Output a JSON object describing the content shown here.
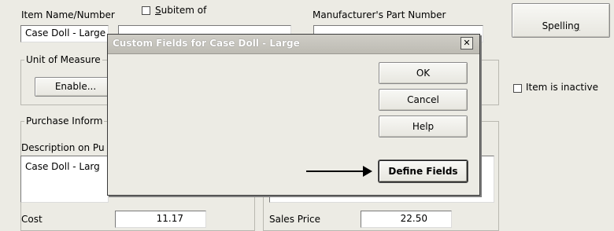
{
  "form": {
    "item_name_label": "Item Name/Number",
    "item_name_value": "Case Doll - Large",
    "subitem_label_u": "S",
    "subitem_label_rest": "ubitem of",
    "mfr_part_label": "Manufacturer's Part Number",
    "spelling_label_main": "Spellin",
    "spelling_label_u": "g",
    "uom_group_label": "Unit of Measure",
    "enable_button": "Enable...",
    "item_inactive_label": "Item is inactive",
    "purchase_group_label": "Purchase Inform",
    "purchase_desc_label": "Description on Pu",
    "purchase_desc_value": "Case Doll - Larg",
    "cost_label": "Cost",
    "cost_value": "11.17",
    "sales_price_label": "Sales Price",
    "sales_price_value": "22.50"
  },
  "dialog": {
    "title": "Custom Fields for Case Doll - Large",
    "close_glyph": "✕",
    "ok_label": "OK",
    "cancel_label": "Cancel",
    "help_label": "Help",
    "define_fields_label": "Define Fields"
  },
  "colors": {
    "background": "#ecebe4",
    "dialog_title_bar": "#c8c6bf",
    "annotation_arrow": "#000000"
  }
}
